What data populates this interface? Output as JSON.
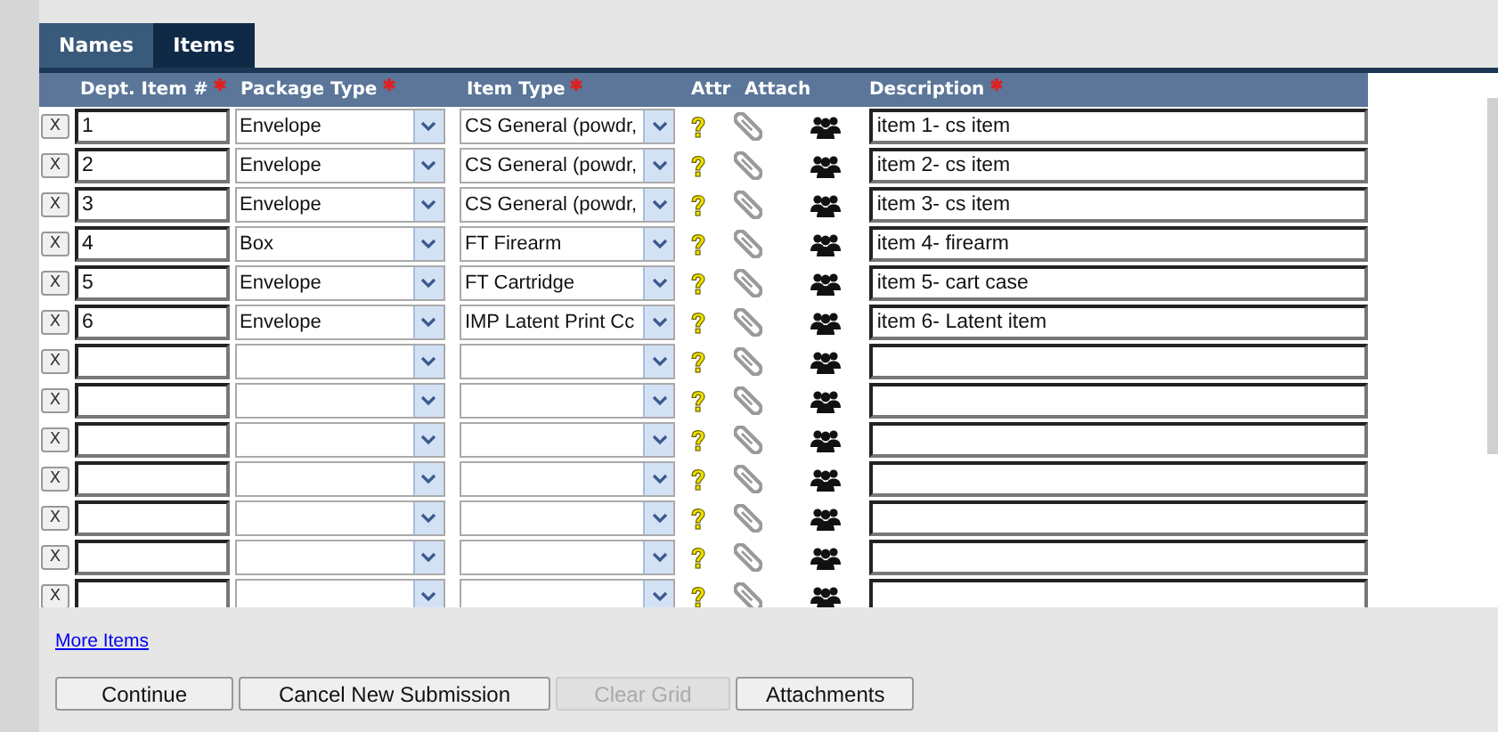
{
  "tabs": [
    {
      "label": "Names",
      "selected": false
    },
    {
      "label": "Items",
      "selected": true
    }
  ],
  "columns": [
    {
      "label": "Dept. Item #",
      "required": true
    },
    {
      "label": "Package Type",
      "required": true
    },
    {
      "label": "Item Type",
      "required": true
    },
    {
      "label": "Attr",
      "required": false
    },
    {
      "label": "Attach",
      "required": false
    },
    {
      "label": "Description",
      "required": true
    }
  ],
  "rows": [
    {
      "remove": "X",
      "dept_item": "1",
      "package_type": "Envelope",
      "item_type": "CS General (powdr,",
      "description": "item 1- cs item"
    },
    {
      "remove": "X",
      "dept_item": "2",
      "package_type": "Envelope",
      "item_type": "CS General (powdr,",
      "description": "item 2- cs item"
    },
    {
      "remove": "X",
      "dept_item": "3",
      "package_type": "Envelope",
      "item_type": "CS General (powdr,",
      "description": "item 3- cs item"
    },
    {
      "remove": "X",
      "dept_item": "4",
      "package_type": "Box",
      "item_type": "FT Firearm",
      "description": "item 4- firearm"
    },
    {
      "remove": "X",
      "dept_item": "5",
      "package_type": "Envelope",
      "item_type": "FT Cartridge",
      "description": "item 5- cart case"
    },
    {
      "remove": "X",
      "dept_item": "6",
      "package_type": "Envelope",
      "item_type": "IMP Latent Print Cc",
      "description": "item 6- Latent item"
    },
    {
      "remove": "X"
    },
    {
      "remove": "X"
    },
    {
      "remove": "X"
    },
    {
      "remove": "X"
    },
    {
      "remove": "X"
    },
    {
      "remove": "X"
    },
    {
      "remove": "X"
    }
  ],
  "more_link": "More Items",
  "buttons": [
    {
      "label": "Continue",
      "disabled": false
    },
    {
      "label": "Cancel New Submission",
      "disabled": false
    },
    {
      "label": "Clear Grid",
      "disabled": true
    },
    {
      "label": "Attachments",
      "disabled": false
    }
  ]
}
